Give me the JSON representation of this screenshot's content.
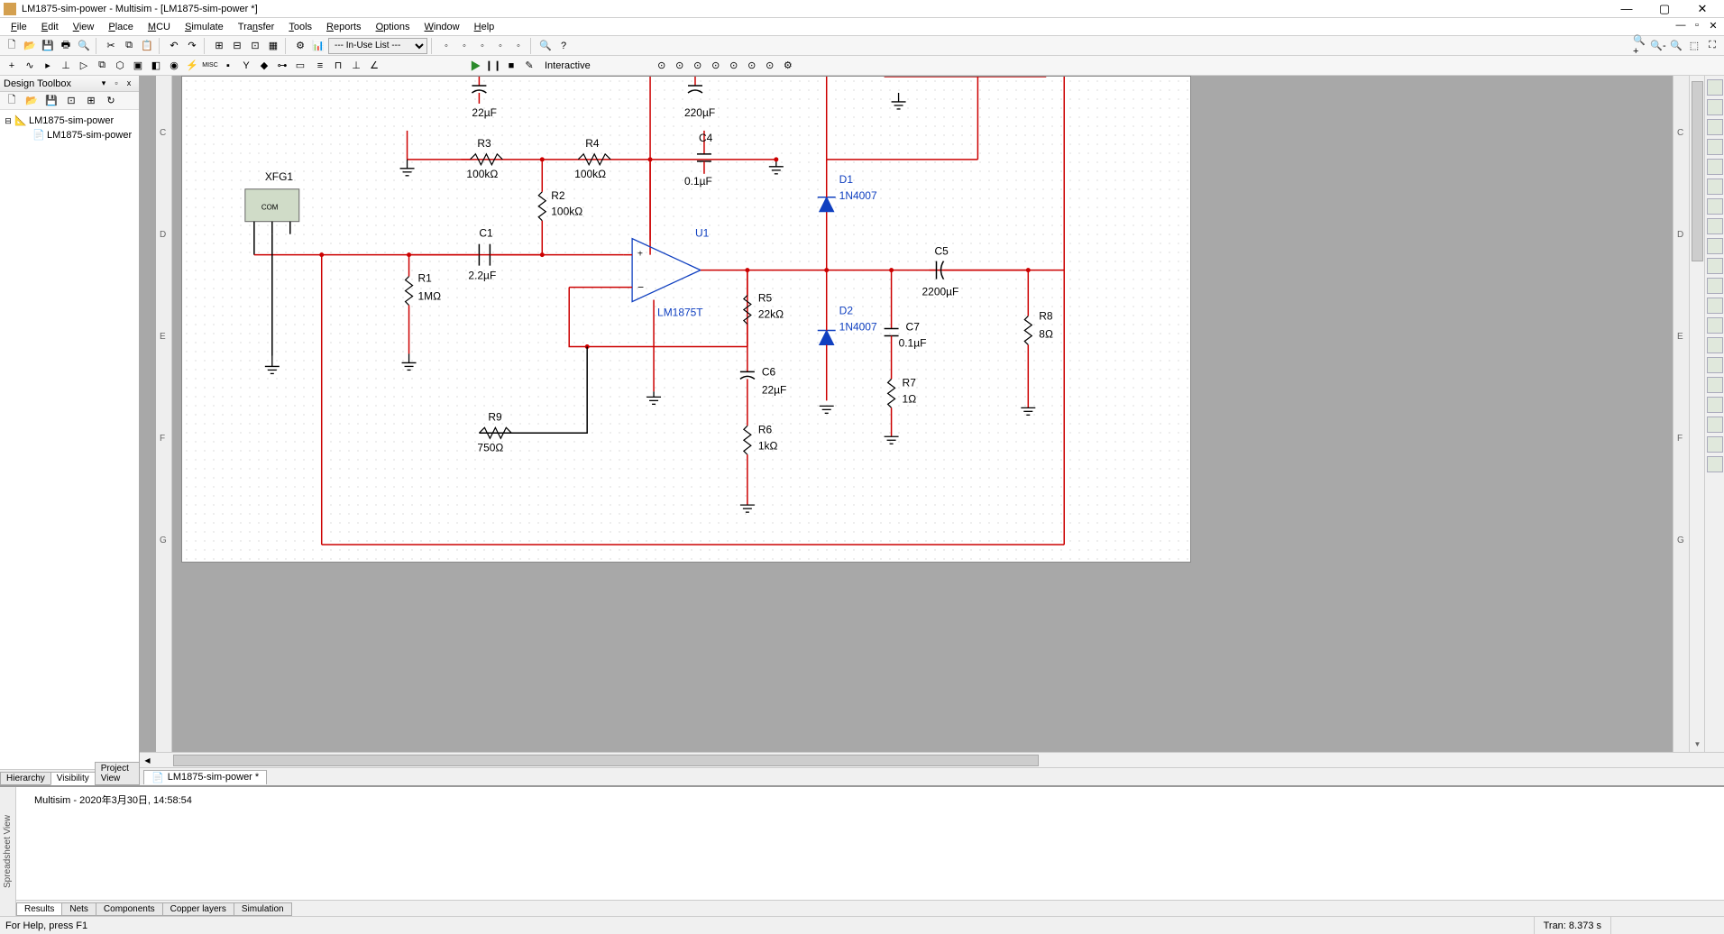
{
  "title": "LM1875-sim-power - Multisim - [LM1875-sim-power *]",
  "menu": [
    "File",
    "Edit",
    "View",
    "Place",
    "MCU",
    "Simulate",
    "Transfer",
    "Tools",
    "Reports",
    "Options",
    "Window",
    "Help"
  ],
  "inuse_list": "--- In-Use List ---",
  "interactive_label": "Interactive",
  "sidebar": {
    "title": "Design Toolbox",
    "tree_root": "LM1875-sim-power",
    "tree_child": "LM1875-sim-power",
    "tabs": [
      "Hierarchy",
      "Visibility",
      "Project View"
    ]
  },
  "ruler_left": [
    "C",
    "D",
    "E",
    "F",
    "G"
  ],
  "ruler_right": [
    "C",
    "D",
    "E",
    "F",
    "G"
  ],
  "doc_tab": "LM1875-sim-power *",
  "spreadsheet": {
    "handle": "Spreadsheet View",
    "log": "Multisim  -  2020年3月30日, 14:58:54",
    "tabs": [
      "Results",
      "Nets",
      "Components",
      "Copper layers",
      "Simulation"
    ]
  },
  "status_left": "For Help, press F1",
  "status_right": "Tran: 8.373 s",
  "components": {
    "XFG1": "XFG1",
    "R1": {
      "name": "R1",
      "val": "1MΩ"
    },
    "R2": {
      "name": "R2",
      "val": "100kΩ"
    },
    "R3": {
      "name": "R3",
      "val": "100kΩ"
    },
    "R4": {
      "name": "R4",
      "val": "100kΩ"
    },
    "R5": {
      "name": "R5",
      "val": "22kΩ"
    },
    "R6": {
      "name": "R6",
      "val": "1kΩ"
    },
    "R7": {
      "name": "R7",
      "val": "1Ω"
    },
    "R8": {
      "name": "R8",
      "val": "8Ω"
    },
    "R9": {
      "name": "R9",
      "val": "750Ω"
    },
    "C1": {
      "name": "C1",
      "val": "2.2µF"
    },
    "C3_val": "22µF",
    "C4_val_top": "220µF",
    "C4": {
      "name": "C4",
      "val": "0.1µF"
    },
    "C5": {
      "name": "C5",
      "val": "2200µF"
    },
    "C6": {
      "name": "C6",
      "val": "22µF"
    },
    "C7": {
      "name": "C7",
      "val": "0.1µF"
    },
    "U1": {
      "name": "U1",
      "model": "LM1875T"
    },
    "D1": {
      "name": "D1",
      "model": "1N4007"
    },
    "D2": {
      "name": "D2",
      "model": "1N4007"
    },
    "xfg_com": "COM"
  }
}
